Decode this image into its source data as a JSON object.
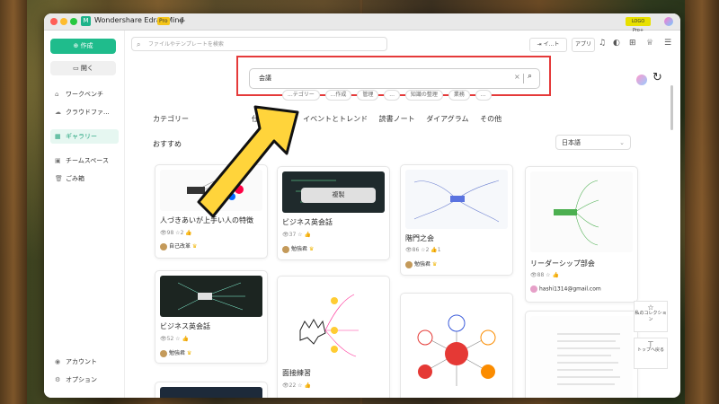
{
  "window": {
    "app_title": "Wondershare EdrawMind",
    "pro_badge": "Pro",
    "new_tab": "+",
    "promo": "LOGO Pro+"
  },
  "sidebar": {
    "create_label": "作成",
    "open_label": "開く",
    "items": [
      {
        "label": "ワークベンチ",
        "icon": "home-icon"
      },
      {
        "label": "クラウドファ...",
        "icon": "cloud-icon"
      },
      {
        "label": "ギャラリー",
        "icon": "gallery-icon"
      },
      {
        "label": "チームスペース",
        "icon": "team-icon"
      },
      {
        "label": "ごみ箱",
        "icon": "trash-icon"
      }
    ],
    "bottom": [
      {
        "label": "アカウント",
        "icon": "account-icon"
      },
      {
        "label": "オプション",
        "icon": "settings-icon"
      }
    ]
  },
  "toolbar": {
    "search_placeholder": "ファイルやテンプレートを検索",
    "import_label": "イ...ト",
    "app_label": "アプリ"
  },
  "gallery_search": {
    "value": "会議",
    "tags": [
      "...テゴリー",
      "...作成",
      "管理",
      "...",
      "知識の整理",
      "業務",
      "..."
    ]
  },
  "categories": {
    "label": "カテゴリー",
    "items": [
      "仕事",
      "生活",
      "イベントとトレンド",
      "読書ノート",
      "ダイアグラム",
      "その他"
    ]
  },
  "recommended_label": "おすすめ",
  "language": {
    "selected": "日本語"
  },
  "cards": [
    {
      "title": "人づきあいが上手い人の特徴",
      "views": "98",
      "likes": "2",
      "author": "自己改革"
    },
    {
      "title": "ビジネス英会話",
      "views": "37",
      "likes": "",
      "author": "勉強君",
      "button": "複製"
    },
    {
      "title": "階門之会",
      "views": "86",
      "likes": "2",
      "comments": "1",
      "author": "勉強君"
    },
    {
      "title": "リーダーシップ部会",
      "views": "88",
      "likes": "",
      "author": "hashi1314@gmail.com"
    },
    {
      "title": "ビジネス英会話",
      "views": "52",
      "likes": "",
      "author": "勉強君"
    },
    {
      "title": "面接練習",
      "views": "22",
      "likes": "",
      "author": ""
    }
  ],
  "float_panel": {
    "collection": "私のコレクション",
    "top": "トップへ戻る"
  }
}
